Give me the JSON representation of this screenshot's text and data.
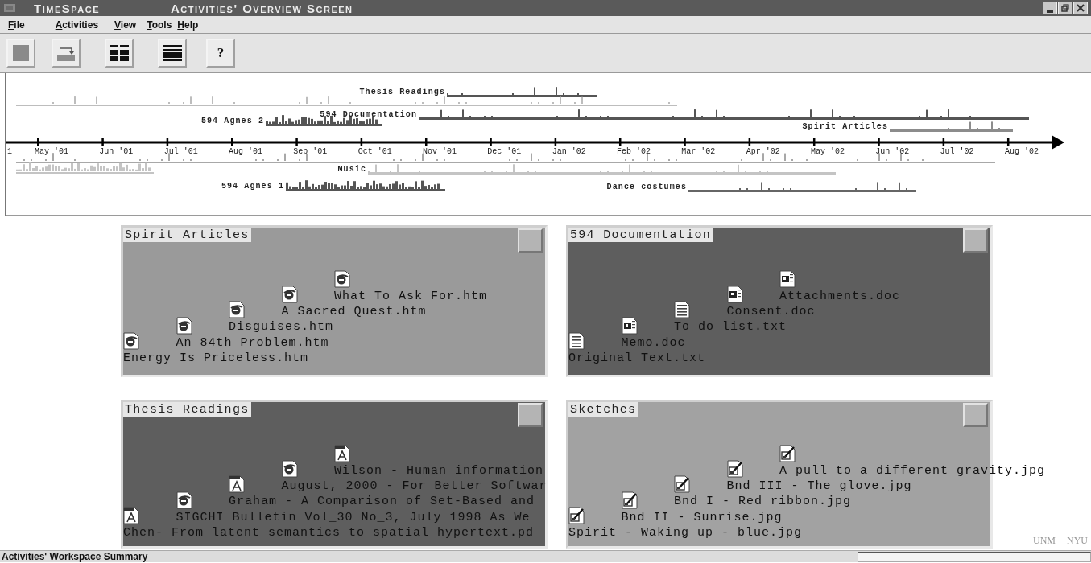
{
  "window": {
    "app_name": "TimeSpace",
    "title": "Activities' Overview Screen"
  },
  "menu": [
    "File",
    "Activities",
    "View",
    "Tools",
    "Help"
  ],
  "toolbar": [
    {
      "kind": "stop"
    },
    {
      "kind": "import"
    },
    {
      "kind": "grid"
    },
    {
      "kind": "list"
    },
    {
      "kind": "help",
      "label": "?"
    }
  ],
  "timeline": {
    "months": [
      "1",
      "May '01",
      "Jun '01",
      "Jul '01",
      "Aug '01",
      "Sep '01",
      "Oct '01",
      "Nov '01",
      "Dec '01",
      "Jan '02",
      "Feb '02",
      "Mar '02",
      "Apr '02",
      "May '02",
      "Jun '02",
      "Jul '02",
      "Aug '02"
    ],
    "tracks": [
      {
        "label": "Thesis Readings"
      },
      {
        "kind": "unlabeled"
      },
      {
        "label": "594 Documentation"
      },
      {
        "label": "594 Agnes 2"
      },
      {
        "label": "Spirit Articles"
      },
      {
        "kind": "unlabeled"
      },
      {
        "kind": "unlabeled"
      },
      {
        "label": "Music"
      },
      {
        "label": "594 Agnes 1"
      },
      {
        "label": "Dance costumes"
      }
    ]
  },
  "activities": [
    {
      "title": "Spirit Articles",
      "color": "#9a9a9a",
      "items": [
        {
          "name": "What To Ask For.htm",
          "kind": "web"
        },
        {
          "name": "A Sacred Quest.htm",
          "kind": "web"
        },
        {
          "name": "Disguises.htm",
          "kind": "web"
        },
        {
          "name": "An 84th Problem.htm",
          "kind": "web"
        },
        {
          "name": "Energy Is Priceless.htm",
          "kind": "web"
        }
      ]
    },
    {
      "title": "594 Documentation",
      "color": "#5e5e5e",
      "items": [
        {
          "name": "Attachments.doc",
          "kind": "doc"
        },
        {
          "name": "Consent.doc",
          "kind": "doc"
        },
        {
          "name": "To do list.txt",
          "kind": "txt"
        },
        {
          "name": "Memo.doc",
          "kind": "doc"
        },
        {
          "name": "Original Text.txt",
          "kind": "txt"
        }
      ]
    },
    {
      "title": "Thesis Readings",
      "color": "#5e5e5e",
      "items": [
        {
          "name": "Wilson - Human information",
          "kind": "pdf"
        },
        {
          "name": "August, 2000 - For Better Softwar",
          "kind": "web"
        },
        {
          "name": "Graham - A Comparison of Set-Based and",
          "kind": "pdf"
        },
        {
          "name": "SIGCHI Bulletin Vol_30 No_3, July 1998 As We",
          "kind": "web"
        },
        {
          "name": "Chen- From latent semantics to spatial hypertext.pd",
          "kind": "pdf"
        }
      ]
    },
    {
      "title": "Sketches",
      "color": "#a2a2a2",
      "items": [
        {
          "name": "A pull to a different gravity.jpg",
          "kind": "jpg"
        },
        {
          "name": "Bnd III - The glove.jpg",
          "kind": "jpg"
        },
        {
          "name": "Bnd I - Red ribbon.jpg",
          "kind": "jpg"
        },
        {
          "name": "Bnd II - Sunrise.jpg",
          "kind": "jpg"
        },
        {
          "name": "Spirit - Waking up - blue.jpg",
          "kind": "jpg"
        }
      ]
    }
  ],
  "footer_marks": [
    "UNM",
    "NYU"
  ],
  "status_bar": {
    "summary": "Activities' Workspace Summary"
  }
}
